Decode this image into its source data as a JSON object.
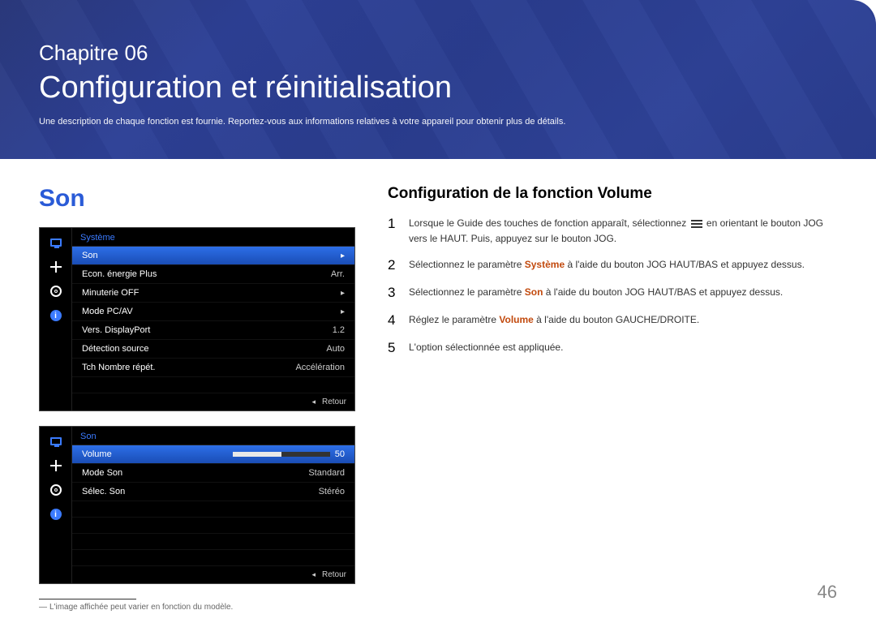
{
  "header": {
    "chapter_label": "Chapitre 06",
    "chapter_title": "Configuration et réinitialisation",
    "chapter_desc": "Une description de chaque fonction est fournie. Reportez-vous aux informations relatives à votre appareil pour obtenir plus de détails."
  },
  "section": {
    "title": "Son",
    "subsection_title": "Configuration de la fonction Volume"
  },
  "osd1": {
    "header": "Système",
    "rows": [
      {
        "label": "Son",
        "value": "",
        "arrow": true,
        "selected": true
      },
      {
        "label": "Econ. énergie Plus",
        "value": "Arr.",
        "arrow": false,
        "selected": false
      },
      {
        "label": "Minuterie OFF",
        "value": "",
        "arrow": true,
        "selected": false
      },
      {
        "label": "Mode PC/AV",
        "value": "",
        "arrow": true,
        "selected": false
      },
      {
        "label": "Vers. DisplayPort",
        "value": "1.2",
        "arrow": false,
        "selected": false
      },
      {
        "label": "Détection source",
        "value": "Auto",
        "arrow": false,
        "selected": false
      },
      {
        "label": "Tch Nombre répét.",
        "value": "Accélération",
        "arrow": false,
        "selected": false
      }
    ],
    "footer": "Retour"
  },
  "osd2": {
    "header": "Son",
    "rows": [
      {
        "label": "Volume",
        "value": "50",
        "slider": true,
        "selected": true
      },
      {
        "label": "Mode Son",
        "value": "Standard",
        "selected": false
      },
      {
        "label": "Sélec. Son",
        "value": "Stéréo",
        "selected": false
      }
    ],
    "footer": "Retour"
  },
  "footnote": "L'image affichée peut varier en fonction du modèle.",
  "steps": [
    {
      "num": "1",
      "pre": "Lorsque le Guide des touches de fonction apparaît, sélectionnez ",
      "post": " en orientant le bouton JOG vers le HAUT. Puis, appuyez sur le bouton JOG.",
      "icon": true
    },
    {
      "num": "2",
      "pre": "Sélectionnez le paramètre ",
      "kw": "Système",
      "post": " à l'aide du bouton JOG HAUT/BAS et appuyez dessus."
    },
    {
      "num": "3",
      "pre": "Sélectionnez le paramètre ",
      "kw": "Son",
      "post": " à l'aide du bouton JOG HAUT/BAS et appuyez dessus."
    },
    {
      "num": "4",
      "pre": "Réglez le paramètre ",
      "kw": "Volume",
      "post": " à l'aide du bouton GAUCHE/DROITE."
    },
    {
      "num": "5",
      "pre": "L'option sélectionnée est appliquée."
    }
  ],
  "page_number": "46"
}
